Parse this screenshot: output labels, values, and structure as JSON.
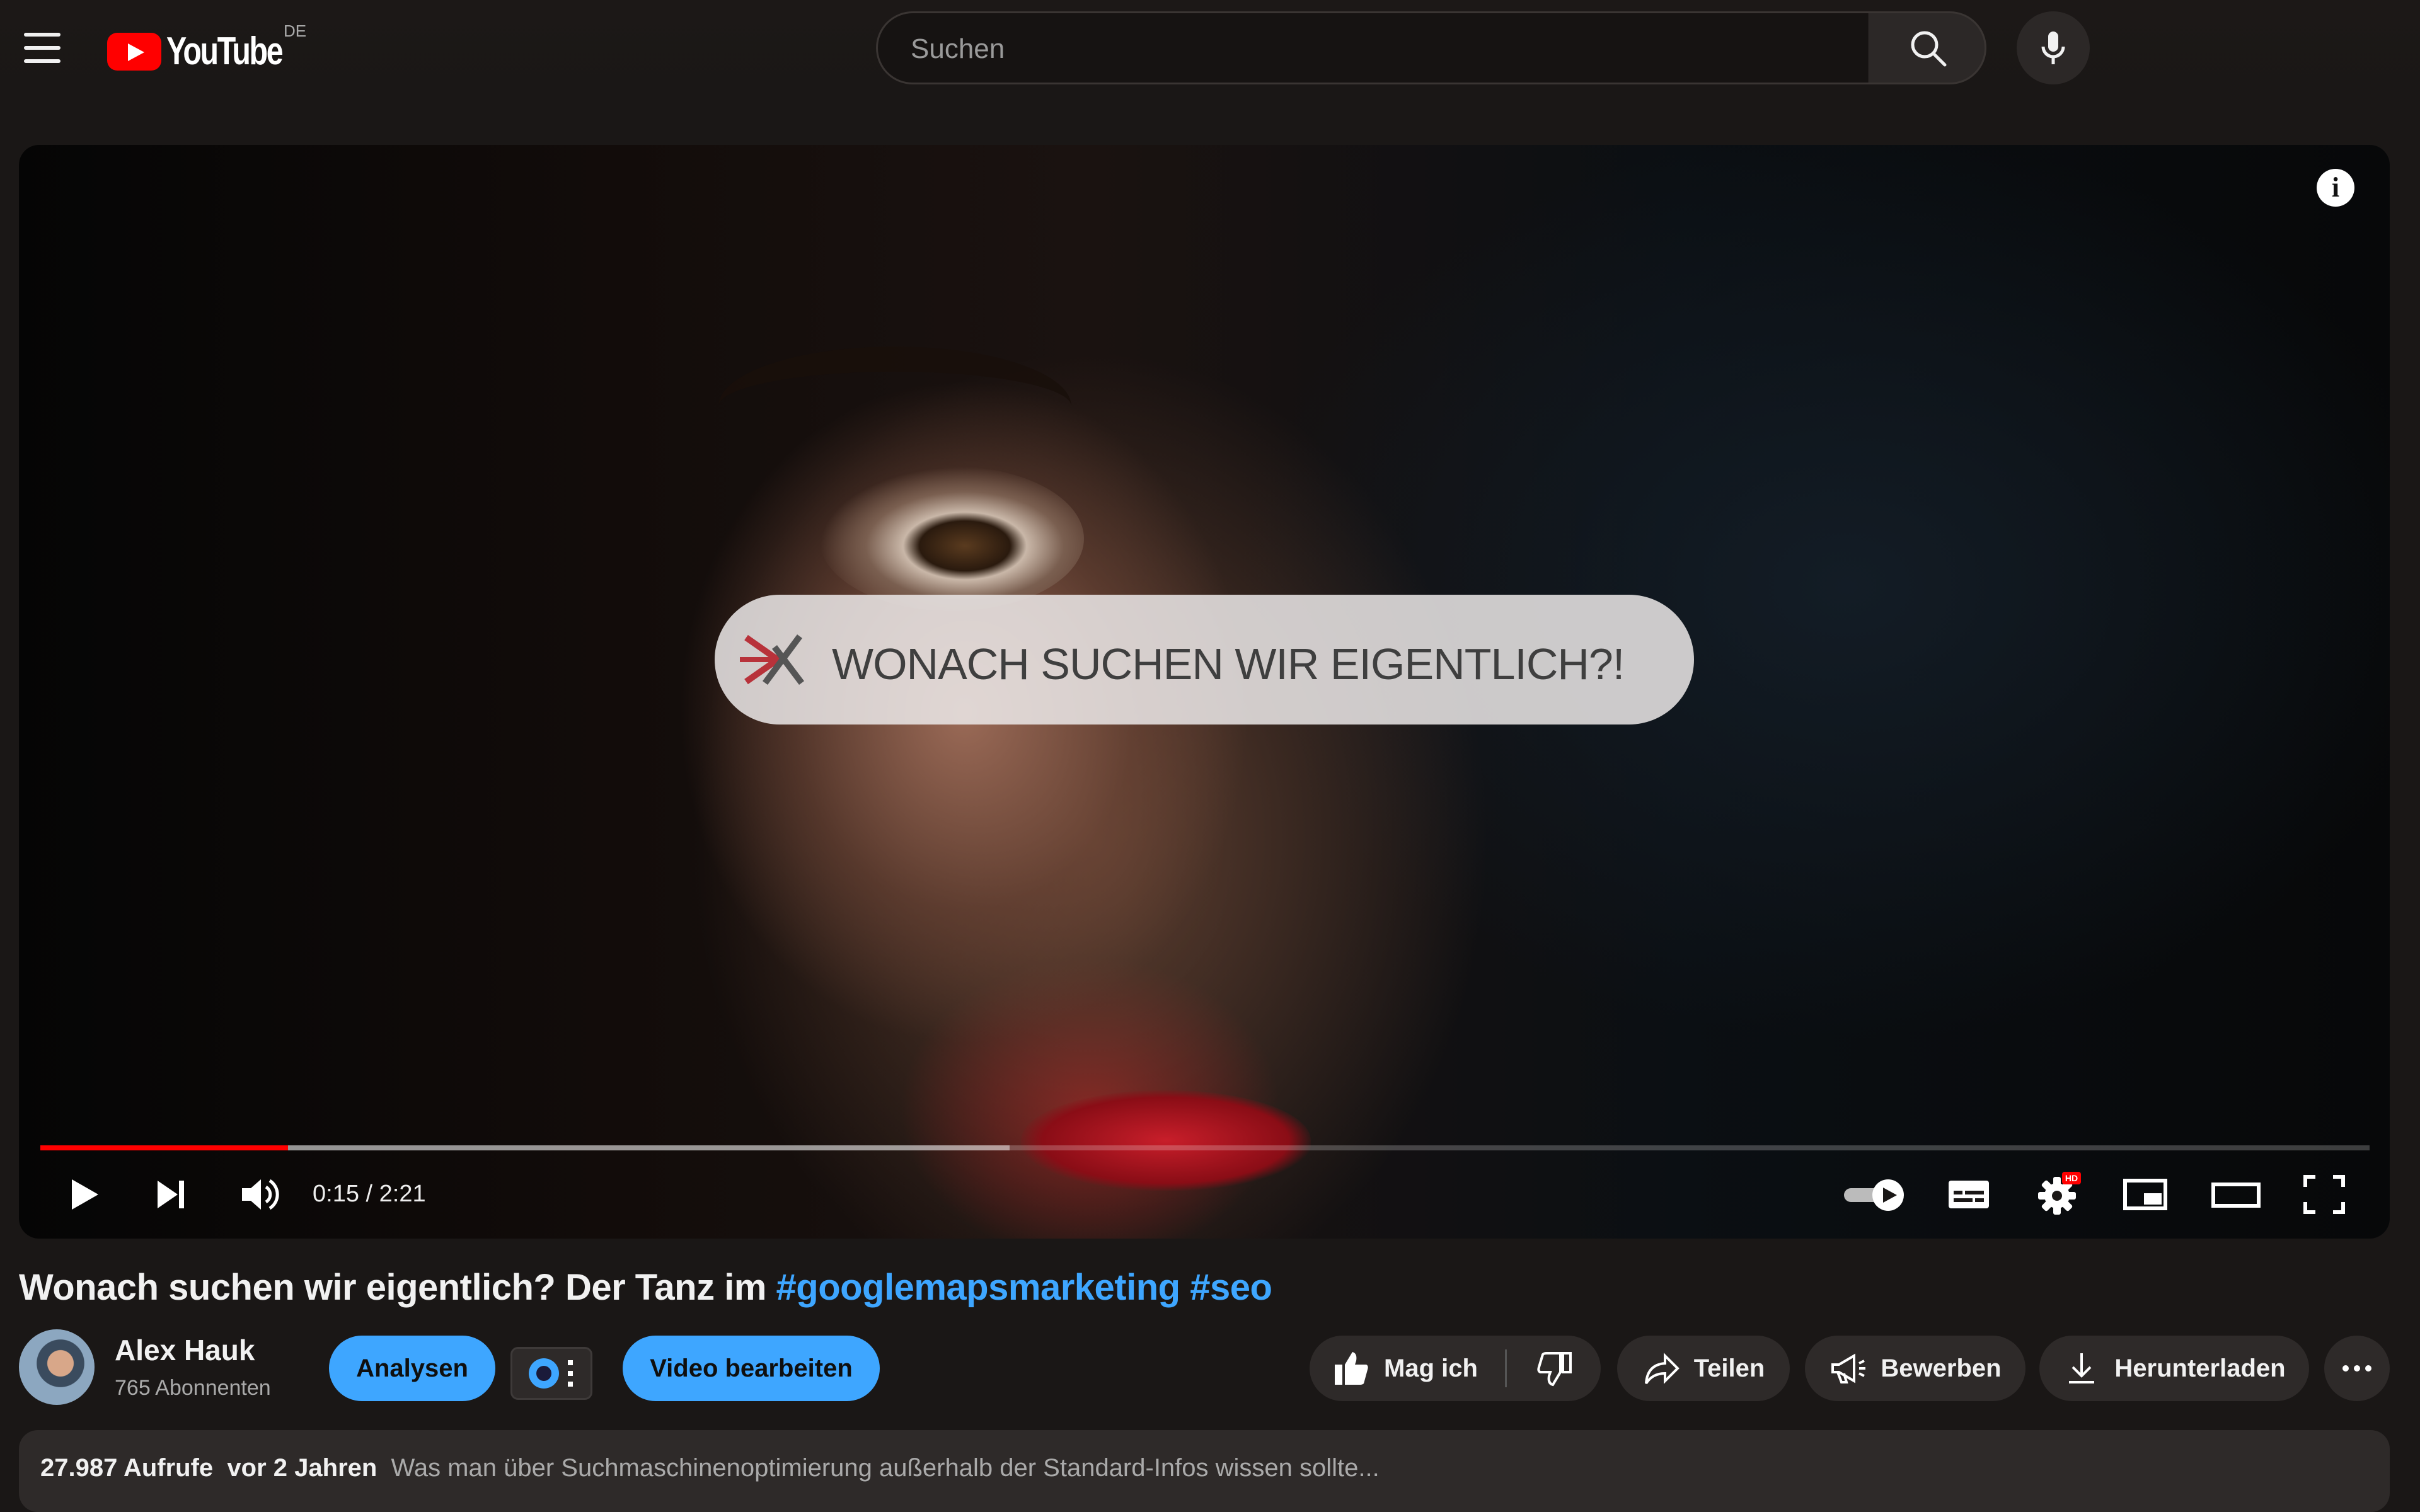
{
  "header": {
    "logo_text": "YouTube",
    "country_code": "DE",
    "search_placeholder": "Suchen"
  },
  "player": {
    "overlay_text": "WONACH SUCHEN WIR EIGENTLICH?!",
    "time_display": "0:15 / 2:21",
    "progress": {
      "played_fraction": 0.1064,
      "buffered_fraction": 0.4162
    },
    "hd_badge": "HD",
    "icons": [
      "info-icon",
      "play-icon",
      "next-icon",
      "volume-icon",
      "autoplay-toggle-icon",
      "subtitles-icon",
      "settings-icon",
      "miniplayer-icon",
      "theater-icon",
      "fullscreen-icon"
    ]
  },
  "video": {
    "title_plain": "Wonach suchen wir eigentlich? Der Tanz im ",
    "hashtag1": "#googlemapsmarketing",
    "hashtag2": "#seo",
    "channel_name": "Alex Hauk",
    "subscribers": "765 Abonnenten",
    "buttons": {
      "analytics": "Analysen",
      "edit": "Video bearbeiten",
      "like": "Mag ich",
      "share": "Teilen",
      "promote": "Bewerben",
      "download": "Herunterladen"
    }
  },
  "description": {
    "views": "27.987 Aufrufe",
    "age": "vor 2 Jahren",
    "snippet": "Was man über Suchmaschinenoptimierung außerhalb der Standard-Infos wissen sollte..."
  },
  "colors": {
    "accent_blue": "#3ea6ff",
    "brand_red": "#ff0000",
    "background": "#1a1716"
  }
}
